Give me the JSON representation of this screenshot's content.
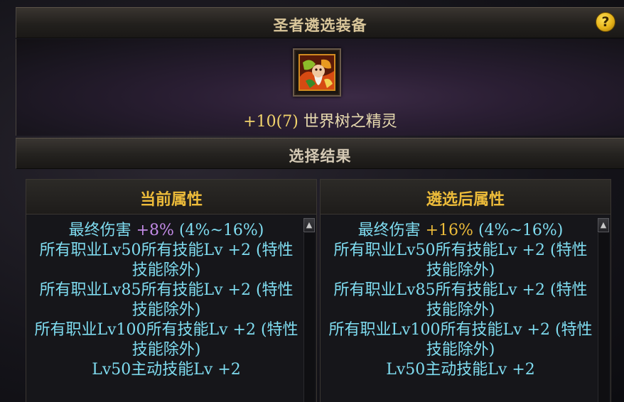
{
  "window": {
    "title": "圣者遴选装备",
    "help_label": "?"
  },
  "item": {
    "enhance": "+10(7)",
    "name": "世界树之精灵"
  },
  "result_section": {
    "title": "选择结果"
  },
  "current_panel": {
    "header": "当前属性",
    "stat_label": "最终伤害",
    "stat_value": "+8%",
    "stat_range": "(4%~16%)",
    "lines": [
      "所有职业Lv50所有技能Lv +2 (特性",
      "技能除外)",
      "所有职业Lv85所有技能Lv +2 (特性",
      "技能除外)",
      "所有职业Lv100所有技能Lv +2 (特性",
      "技能除外)",
      "Lv50主动技能Lv +2"
    ]
  },
  "after_panel": {
    "header": "遴选后属性",
    "stat_label": "最终伤害",
    "stat_value": "+16%",
    "stat_range": "(4%~16%)",
    "lines": [
      "所有职业Lv50所有技能Lv +2 (特性",
      "技能除外)",
      "所有职业Lv85所有技能Lv +2 (特性",
      "技能除外)",
      "所有职业Lv100所有技能Lv +2 (特性",
      "技能除外)",
      "Lv50主动技能Lv +2"
    ]
  },
  "scrollbar": {
    "up_icon": "▲"
  },
  "colors": {
    "header_gold": "#ecbb3a",
    "stat_text_cyan": "#7fdcf0",
    "current_value_purple": "#c28ae6",
    "after_value_gold": "#ecbb3a"
  }
}
